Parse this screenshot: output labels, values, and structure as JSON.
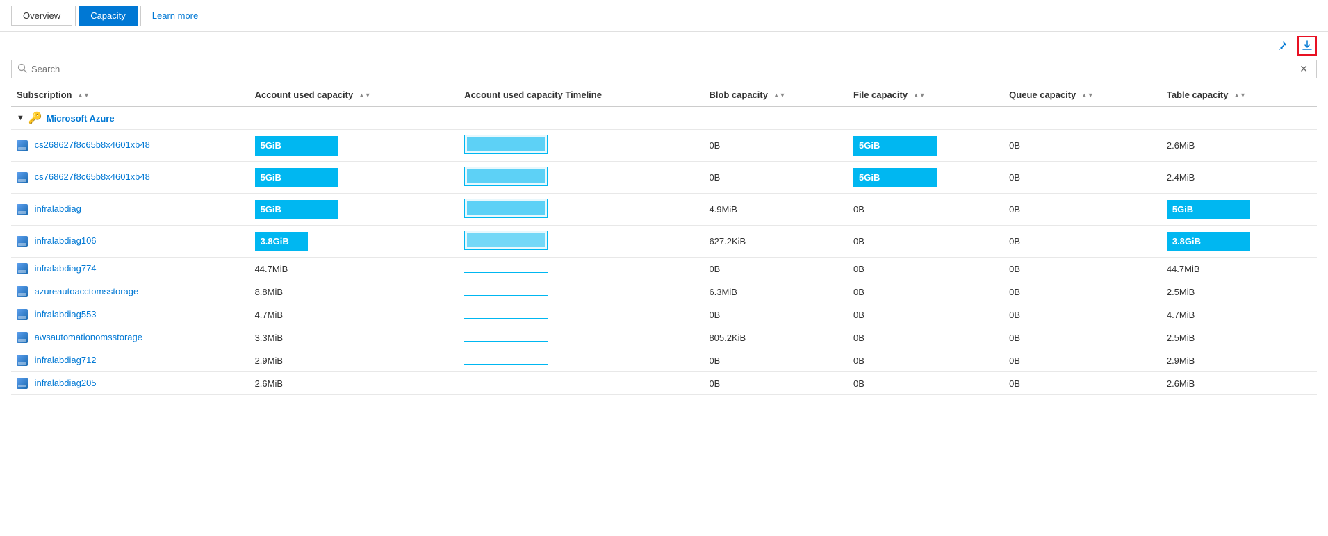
{
  "nav": {
    "overview_label": "Overview",
    "capacity_label": "Capacity",
    "learn_more_label": "Learn more"
  },
  "toolbar": {
    "pin_icon": "📌",
    "download_icon": "⬇"
  },
  "search": {
    "placeholder": "Search",
    "clear_label": "✕"
  },
  "table": {
    "columns": [
      {
        "id": "subscription",
        "label": "Subscription",
        "sortable": true
      },
      {
        "id": "used_capacity",
        "label": "Account used capacity",
        "sortable": true
      },
      {
        "id": "used_capacity_timeline",
        "label": "Account used capacity Timeline",
        "sortable": false
      },
      {
        "id": "blob_capacity",
        "label": "Blob capacity",
        "sortable": true
      },
      {
        "id": "file_capacity",
        "label": "File capacity",
        "sortable": true
      },
      {
        "id": "queue_capacity",
        "label": "Queue capacity",
        "sortable": true
      },
      {
        "id": "table_capacity",
        "label": "Table capacity",
        "sortable": true
      }
    ],
    "group": {
      "name": "Microsoft Azure",
      "icon": "key"
    },
    "rows": [
      {
        "name": "cs268627f8c65b8x4601xb48",
        "used_capacity": "5GiB",
        "used_capacity_type": "bar_full",
        "timeline_type": "bar_box",
        "blob_capacity": "0B",
        "file_capacity": "5GiB",
        "file_capacity_type": "bar_full",
        "queue_capacity": "0B",
        "table_capacity": "2.6MiB",
        "table_capacity_type": "text"
      },
      {
        "name": "cs768627f8c65b8x4601xb48",
        "used_capacity": "5GiB",
        "used_capacity_type": "bar_full",
        "timeline_type": "bar_box",
        "blob_capacity": "0B",
        "file_capacity": "5GiB",
        "file_capacity_type": "bar_full",
        "queue_capacity": "0B",
        "table_capacity": "2.4MiB",
        "table_capacity_type": "text"
      },
      {
        "name": "infralabdiag",
        "used_capacity": "5GiB",
        "used_capacity_type": "bar_full",
        "timeline_type": "bar_box",
        "blob_capacity": "4.9MiB",
        "file_capacity": "0B",
        "file_capacity_type": "text",
        "queue_capacity": "0B",
        "table_capacity": "5GiB",
        "table_capacity_type": "bar_full"
      },
      {
        "name": "infralabdiag106",
        "used_capacity": "3.8GiB",
        "used_capacity_type": "bar_partial",
        "timeline_type": "bar_box_partial",
        "blob_capacity": "627.2KiB",
        "file_capacity": "0B",
        "file_capacity_type": "text",
        "queue_capacity": "0B",
        "table_capacity": "3.8GiB",
        "table_capacity_type": "bar_full"
      },
      {
        "name": "infralabdiag774",
        "used_capacity": "44.7MiB",
        "used_capacity_type": "text",
        "timeline_type": "line",
        "blob_capacity": "0B",
        "file_capacity": "0B",
        "file_capacity_type": "text",
        "queue_capacity": "0B",
        "table_capacity": "44.7MiB",
        "table_capacity_type": "text"
      },
      {
        "name": "azureautoacctomsstorage",
        "used_capacity": "8.8MiB",
        "used_capacity_type": "text",
        "timeline_type": "line",
        "blob_capacity": "6.3MiB",
        "file_capacity": "0B",
        "file_capacity_type": "text",
        "queue_capacity": "0B",
        "table_capacity": "2.5MiB",
        "table_capacity_type": "text"
      },
      {
        "name": "infralabdiag553",
        "used_capacity": "4.7MiB",
        "used_capacity_type": "text",
        "timeline_type": "line",
        "blob_capacity": "0B",
        "file_capacity": "0B",
        "file_capacity_type": "text",
        "queue_capacity": "0B",
        "table_capacity": "4.7MiB",
        "table_capacity_type": "text"
      },
      {
        "name": "awsautomationomsstorage",
        "used_capacity": "3.3MiB",
        "used_capacity_type": "text",
        "timeline_type": "line",
        "blob_capacity": "805.2KiB",
        "file_capacity": "0B",
        "file_capacity_type": "text",
        "queue_capacity": "0B",
        "table_capacity": "2.5MiB",
        "table_capacity_type": "text"
      },
      {
        "name": "infralabdiag712",
        "used_capacity": "2.9MiB",
        "used_capacity_type": "text",
        "timeline_type": "line",
        "blob_capacity": "0B",
        "file_capacity": "0B",
        "file_capacity_type": "text",
        "queue_capacity": "0B",
        "table_capacity": "2.9MiB",
        "table_capacity_type": "text"
      },
      {
        "name": "infralabdiag205",
        "used_capacity": "2.6MiB",
        "used_capacity_type": "text",
        "timeline_type": "line",
        "blob_capacity": "0B",
        "file_capacity": "0B",
        "file_capacity_type": "text",
        "queue_capacity": "0B",
        "table_capacity": "2.6MiB",
        "table_capacity_type": "text"
      }
    ]
  }
}
